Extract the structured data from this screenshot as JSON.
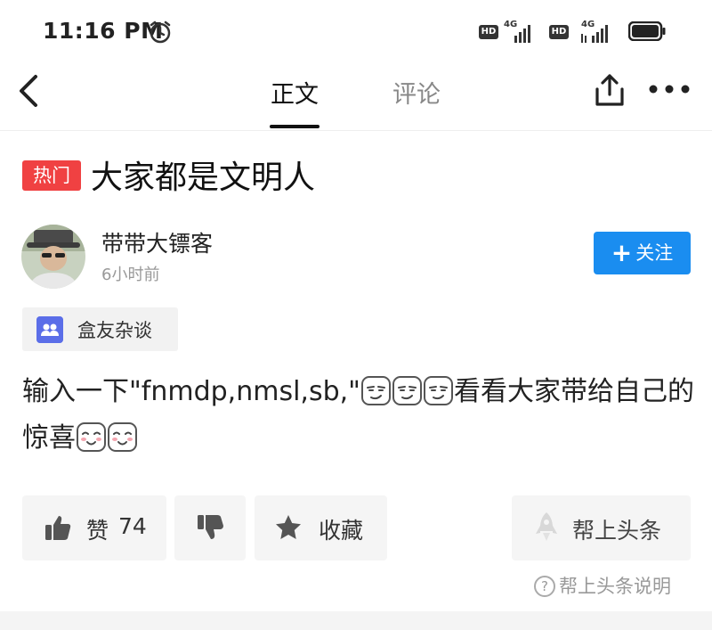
{
  "status_bar": {
    "time": "11:16 PM",
    "sim1": {
      "hd": "HD",
      "network": "4G"
    },
    "sim2": {
      "hd": "HD",
      "network": "4G"
    },
    "icons": [
      "alarm-icon",
      "signal-icon",
      "battery-icon"
    ]
  },
  "nav": {
    "tabs": [
      {
        "label": "正文",
        "active": true
      },
      {
        "label": "评论",
        "active": false
      }
    ],
    "icons": [
      "back-arrow-icon",
      "share-icon",
      "more-icon"
    ]
  },
  "post": {
    "badge": "热门",
    "title": "大家都是文明人",
    "author": {
      "name": "带带大镖客",
      "time": "6小时前"
    },
    "follow_label": "关注",
    "group_label": "盒友杂谈",
    "text_part1": "输入一下\"fnmdp,nmsl,sb,\"",
    "text_part2": "看看大家带给自己的惊喜",
    "emojis": [
      "smirk-face-emoji",
      "smirk-face-emoji",
      "smirk-face-emoji",
      "blush-face-emoji",
      "blush-face-emoji"
    ]
  },
  "actions": {
    "like_label": "赞",
    "like_count": "74",
    "favorite_label": "收藏",
    "boost_label": "帮上头条",
    "help_label": "帮上头条说明"
  },
  "colors": {
    "badge_red": "#f04142",
    "follow_blue": "#1a8df0",
    "group_icon": "#5b6ee8"
  }
}
